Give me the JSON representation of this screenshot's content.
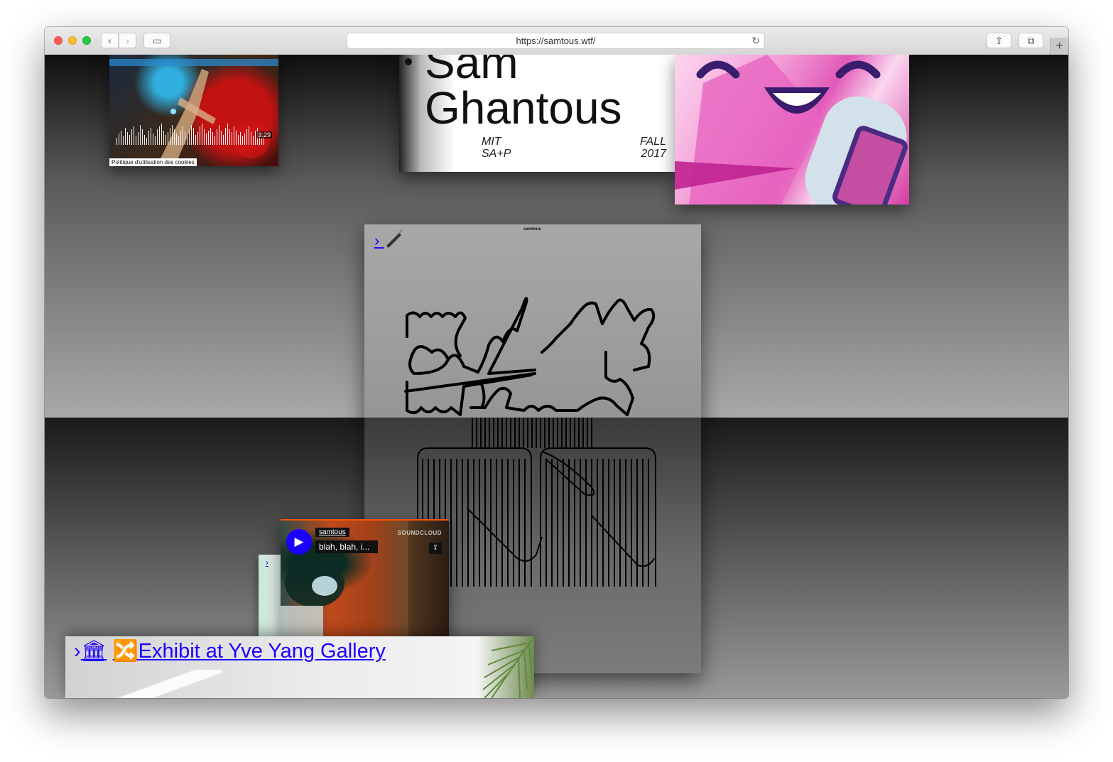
{
  "browser": {
    "url": "https://samtous.wtf/",
    "back_label": "‹",
    "forward_label": "›",
    "sidebar_label": "▭",
    "share_label": "⇧",
    "tabs_label": "⧉",
    "new_tab_label": "+",
    "reload_label": "↻"
  },
  "video": {
    "duration": "3:29",
    "cookie_notice": "Politique d'utilisation des cookies"
  },
  "name_card": {
    "first": "Sam",
    "last": "Ghantous",
    "school_line1": "MIT",
    "school_line2": "SA+P",
    "term_line1": "FALL",
    "term_line2": "2017"
  },
  "drawing": {
    "arrow": "›",
    "pen_icon": "pen-icon",
    "small_title": "samtous"
  },
  "mini": {
    "arrow": "›"
  },
  "soundcloud": {
    "user": "samtous",
    "track": "blah, blah, i...",
    "logo": "SOUNDCLOUD",
    "play_icon": "play-icon",
    "share_icon": "share-icon",
    "accent": "#ff5500"
  },
  "exhibit": {
    "arrow": "›",
    "museum_emoji": "🏛",
    "shuffle_emoji": "🔀",
    "label": "Exhibit at Yve Yang Gallery"
  },
  "colors": {
    "link": "#1c00ff",
    "play_button": "#1c00ff"
  }
}
